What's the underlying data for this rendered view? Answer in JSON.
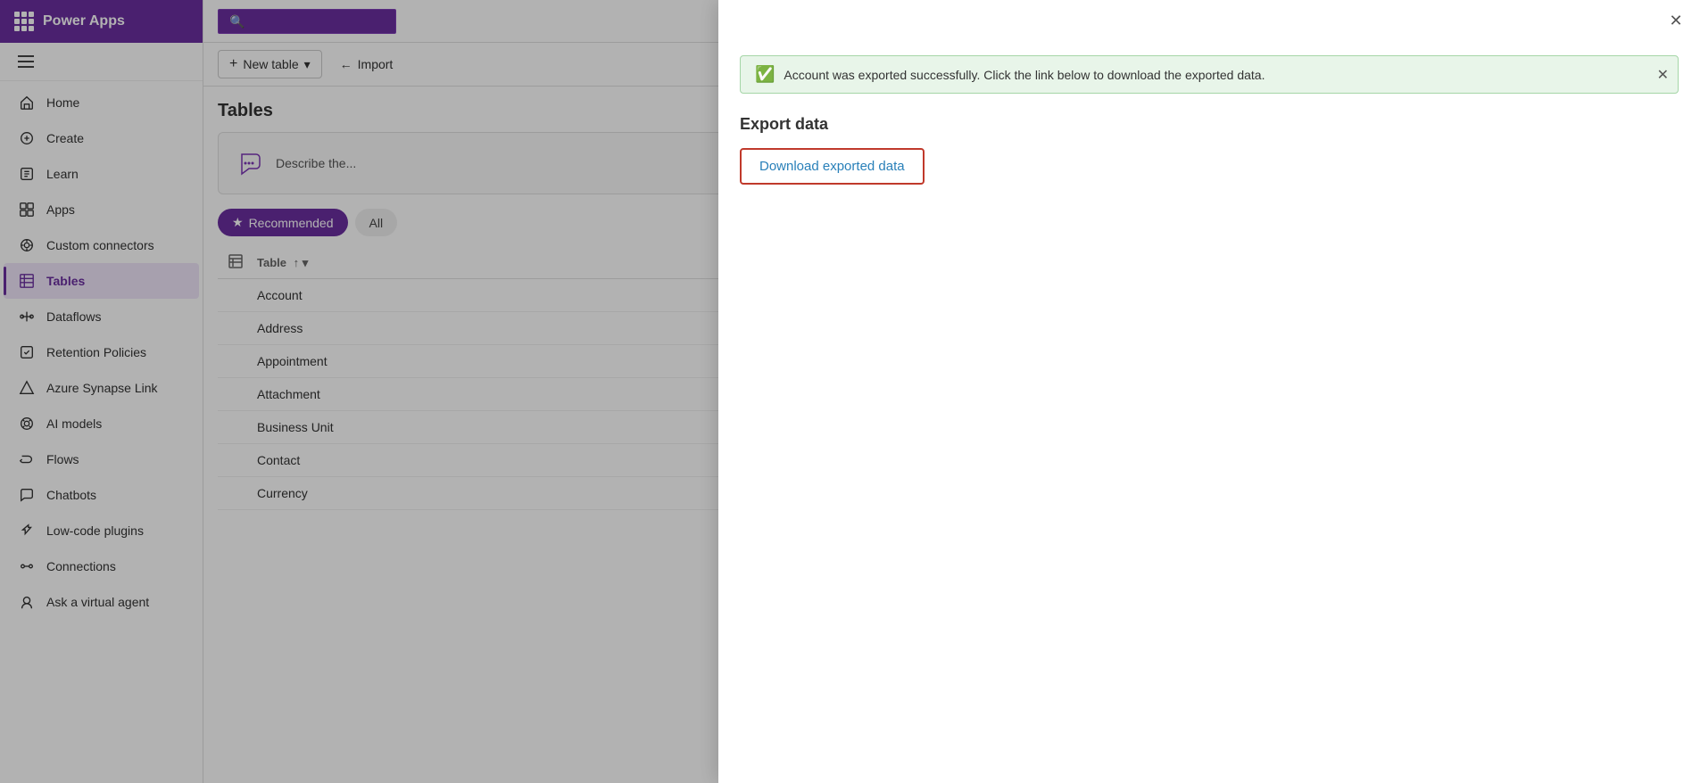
{
  "app": {
    "name": "Power Apps"
  },
  "sidebar": {
    "items": [
      {
        "id": "home",
        "label": "Home",
        "icon": "home-icon"
      },
      {
        "id": "create",
        "label": "Create",
        "icon": "create-icon"
      },
      {
        "id": "learn",
        "label": "Learn",
        "icon": "learn-icon"
      },
      {
        "id": "apps",
        "label": "Apps",
        "icon": "apps-icon"
      },
      {
        "id": "custom-connectors",
        "label": "Custom connectors",
        "icon": "custom-connectors-icon"
      },
      {
        "id": "tables",
        "label": "Tables",
        "icon": "tables-icon",
        "active": true
      },
      {
        "id": "dataflows",
        "label": "Dataflows",
        "icon": "dataflows-icon"
      },
      {
        "id": "retention-policies",
        "label": "Retention Policies",
        "icon": "retention-icon"
      },
      {
        "id": "azure-synapse",
        "label": "Azure Synapse Link",
        "icon": "azure-icon"
      },
      {
        "id": "ai-models",
        "label": "AI models",
        "icon": "ai-icon"
      },
      {
        "id": "flows",
        "label": "Flows",
        "icon": "flows-icon"
      },
      {
        "id": "chatbots",
        "label": "Chatbots",
        "icon": "chatbots-icon"
      },
      {
        "id": "low-code-plugins",
        "label": "Low-code plugins",
        "icon": "plugins-icon"
      },
      {
        "id": "connections",
        "label": "Connections",
        "icon": "connections-icon"
      },
      {
        "id": "ask-virtual-agent",
        "label": "Ask a virtual agent",
        "icon": "agent-icon"
      }
    ]
  },
  "toolbar": {
    "new_table_label": "New table",
    "import_label": "Import",
    "chevron_label": "▾"
  },
  "tables_section": {
    "title": "Tables",
    "ai_describe_placeholder": "Describe the...",
    "filter_tabs": [
      {
        "id": "recommended",
        "label": "Recommended",
        "active": true
      },
      {
        "id": "all",
        "label": "All"
      }
    ],
    "table_col_header": "Table",
    "rows": [
      {
        "name": "Account"
      },
      {
        "name": "Address"
      },
      {
        "name": "Appointment"
      },
      {
        "name": "Attachment"
      },
      {
        "name": "Business Unit"
      },
      {
        "name": "Contact"
      },
      {
        "name": "Currency"
      }
    ]
  },
  "modal": {
    "success_banner": {
      "message": "Account was exported successfully. Click the link below to download the exported data.",
      "close_label": "✕"
    },
    "export_data": {
      "title": "Export data",
      "download_link_label": "Download exported data"
    },
    "close_label": "✕"
  }
}
